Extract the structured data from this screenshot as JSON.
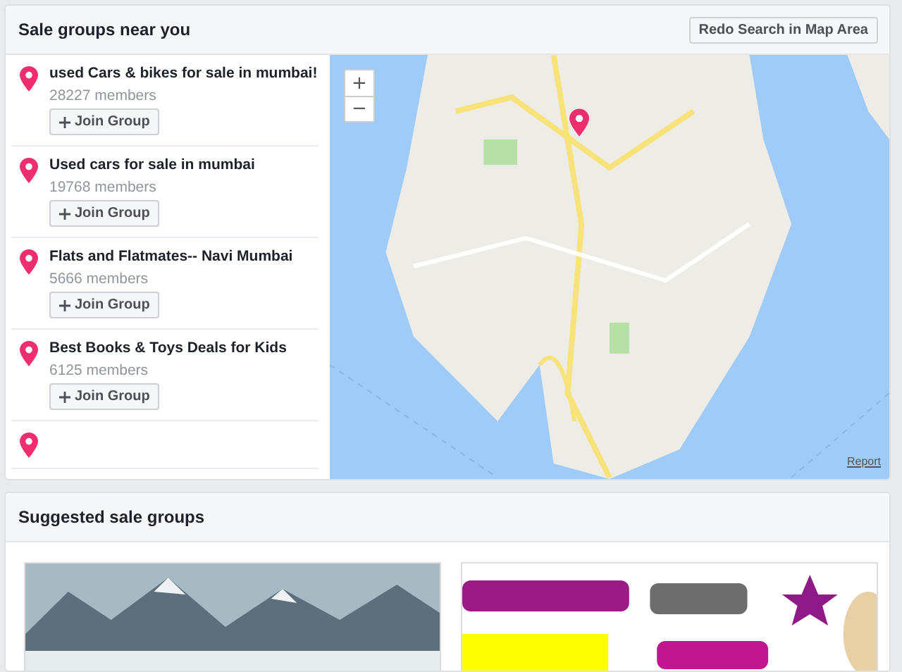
{
  "nearby": {
    "title": "Sale groups near you",
    "redo_button": "Redo Search in Map Area",
    "groups": [
      {
        "name": "used Cars & bikes for sale in mumbai!",
        "members": "28227 members",
        "join": "Join Group"
      },
      {
        "name": "Used cars for sale in mumbai",
        "members": "19768 members",
        "join": "Join Group"
      },
      {
        "name": "Flats and Flatmates-- Navi Mumbai",
        "members": "5666 members",
        "join": "Join Group"
      },
      {
        "name": "Best Books & Toys Deals for Kids",
        "members": "6125 members",
        "join": "Join Group"
      }
    ],
    "map": {
      "kind": "picture",
      "zoom_in": "+",
      "zoom_out": "−",
      "report": "Report"
    }
  },
  "suggested": {
    "title": "Suggested sale groups"
  }
}
